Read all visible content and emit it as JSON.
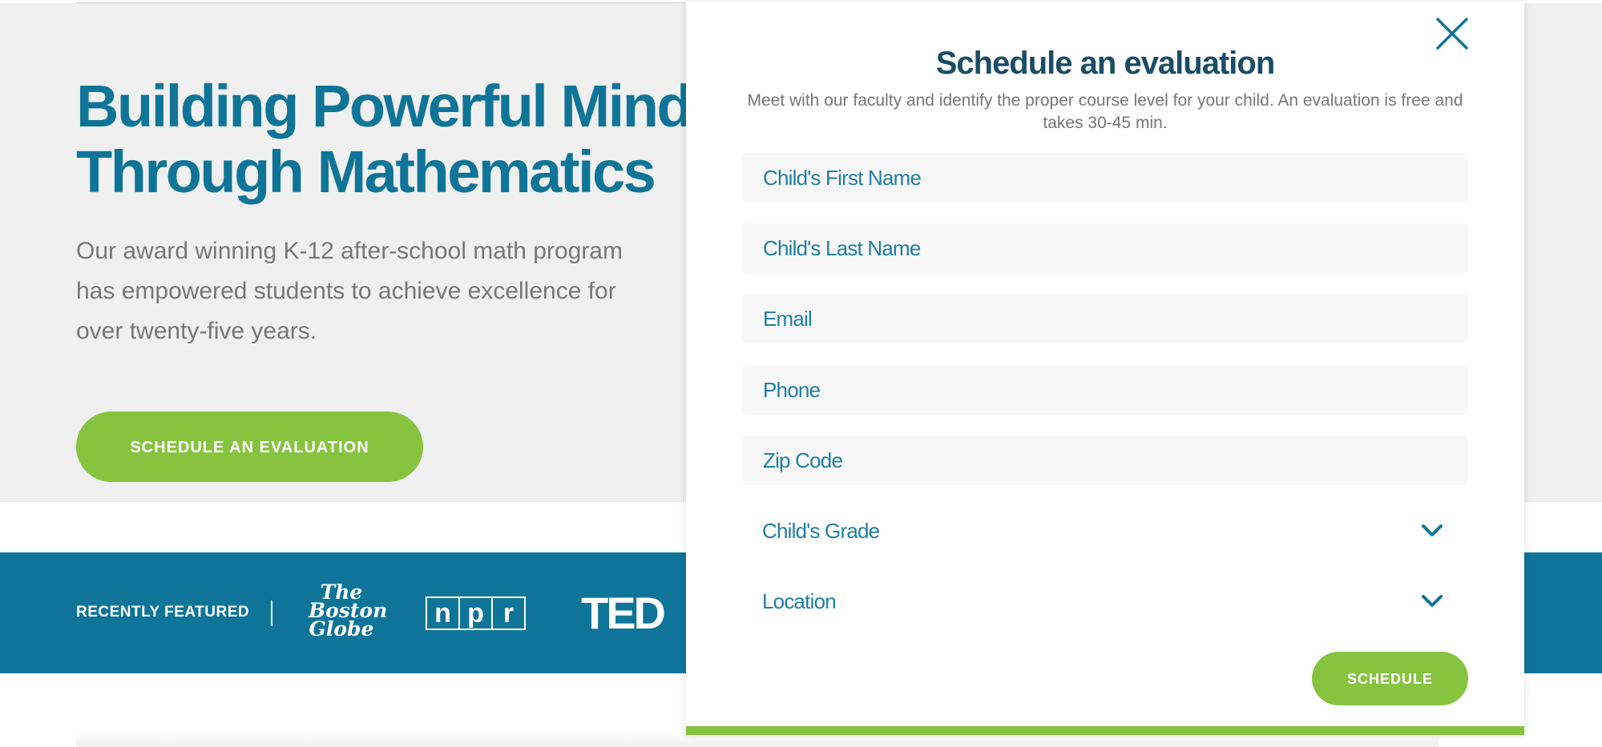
{
  "hero": {
    "title_line1": "Building Powerful Minds",
    "title_line2": "Through Mathematics",
    "subtitle_line1": "Our award winning K-12 after-school math program",
    "subtitle_line2": "has empowered students to achieve excellence for",
    "subtitle_line3": "over twenty-five years.",
    "cta_label": "SCHEDULE AN EVALUATION"
  },
  "featured": {
    "label": "RECENTLY FEATURED",
    "logos": {
      "boston_globe": [
        "The",
        "Boston",
        "Globe"
      ],
      "npr": [
        "n",
        "p",
        "r"
      ],
      "ted": "TED"
    }
  },
  "modal": {
    "title": "Schedule an evaluation",
    "description": "Meet with our faculty and identify the proper course level for your child. An evaluation is free and takes 30-45 min.",
    "fields": {
      "first_name_placeholder": "Child's First Name",
      "last_name_placeholder": "Child's Last Name",
      "email_placeholder": "Email",
      "phone_placeholder": "Phone",
      "zip_placeholder": "Zip Code"
    },
    "selects": {
      "grade_label": "Child's Grade",
      "location_label": "Location"
    },
    "submit_label": "SCHEDULE",
    "icons": {
      "close": "close-icon",
      "chevron": "chevron-down-icon"
    }
  },
  "colors": {
    "brand_blue": "#0f7598",
    "title_dark": "#1a4d66",
    "accent_green": "#86c440",
    "band_blue": "#0e7599",
    "text_gray": "#777777"
  }
}
